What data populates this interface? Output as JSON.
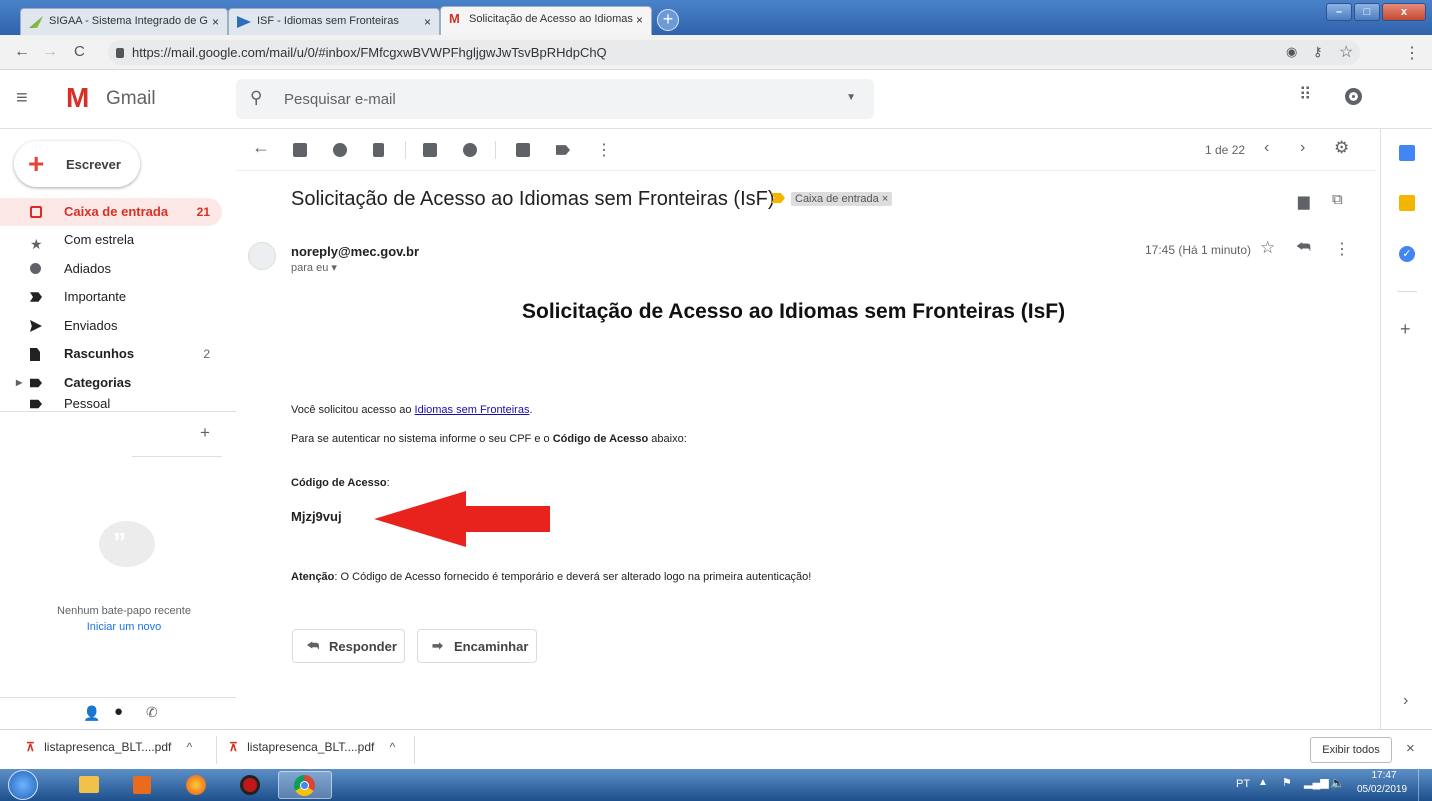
{
  "browser": {
    "tabs": [
      {
        "label": "SIGAA - Sistema Integrado de G",
        "close": "×"
      },
      {
        "label": "ISF - Idiomas sem Fronteiras",
        "close": "×"
      },
      {
        "label": "Solicitação de Acesso ao Idiomas",
        "close": "×"
      }
    ],
    "url": "https://mail.google.com/mail/u/0/#inbox/FMfcgxwBVWPFhgljgwJwTsvBpRHdpChQ"
  },
  "gmail": {
    "logo": "Gmail",
    "search_placeholder": "Pesquisar e-mail",
    "compose": "Escrever",
    "nav": [
      {
        "label": "Caixa de entrada",
        "count": "21",
        "icon": "inbox-icon"
      },
      {
        "label": "Com estrela",
        "count": "",
        "icon": "star-icon"
      },
      {
        "label": "Adiados",
        "count": "",
        "icon": "clock-icon"
      },
      {
        "label": "Importante",
        "count": "",
        "icon": "important-icon"
      },
      {
        "label": "Enviados",
        "count": "",
        "icon": "send-icon"
      },
      {
        "label": "Rascunhos",
        "count": "2",
        "icon": "draft-icon"
      },
      {
        "label": "Categorias",
        "count": "",
        "icon": "label-icon"
      },
      {
        "label": "Pessoal",
        "count": "",
        "icon": "label-icon"
      }
    ],
    "chat": {
      "empty": "Nenhum bate-papo recente",
      "start": "Iniciar um novo"
    },
    "pagination": "1 de 22"
  },
  "email": {
    "subject": "Solicitação de Acesso ao Idiomas sem Fronteiras (IsF)",
    "label": "Caixa de entrada ×",
    "sender": "noreply@mec.gov.br",
    "to": "para eu",
    "time": "17:45 (Há 1 minuto)",
    "heading": "Solicitação de Acesso ao Idiomas sem Fronteiras (IsF)",
    "line1_pre": "Você solicitou acesso ao ",
    "line1_link": "Idiomas sem Fronteiras",
    "line1_post": ".",
    "line2_pre": "Para se autenticar no sistema informe o seu CPF e o ",
    "line2_bold": "Código de Acesso",
    "line2_post": " abaixo:",
    "code_label": "Código de Acesso",
    "code_colon": ":",
    "code": "Mjzj9vuj",
    "attention_bold": "Atenção",
    "attention_text": ": O Código de Acesso fornecido é temporário e deverá ser alterado logo na primeira autenticação!",
    "reply": "Responder",
    "forward": "Encaminhar"
  },
  "downloads": {
    "items": [
      "listapresenca_BLT....pdf",
      "listapresenca_BLT....pdf"
    ],
    "show_all": "Exibir todos"
  },
  "taskbar": {
    "lang": "PT",
    "time": "17:47",
    "date": "05/02/2019"
  },
  "colors": {
    "accent_red": "#d93025",
    "gmail_blue": "#1a73e8",
    "arrow_red": "#e8221d"
  }
}
